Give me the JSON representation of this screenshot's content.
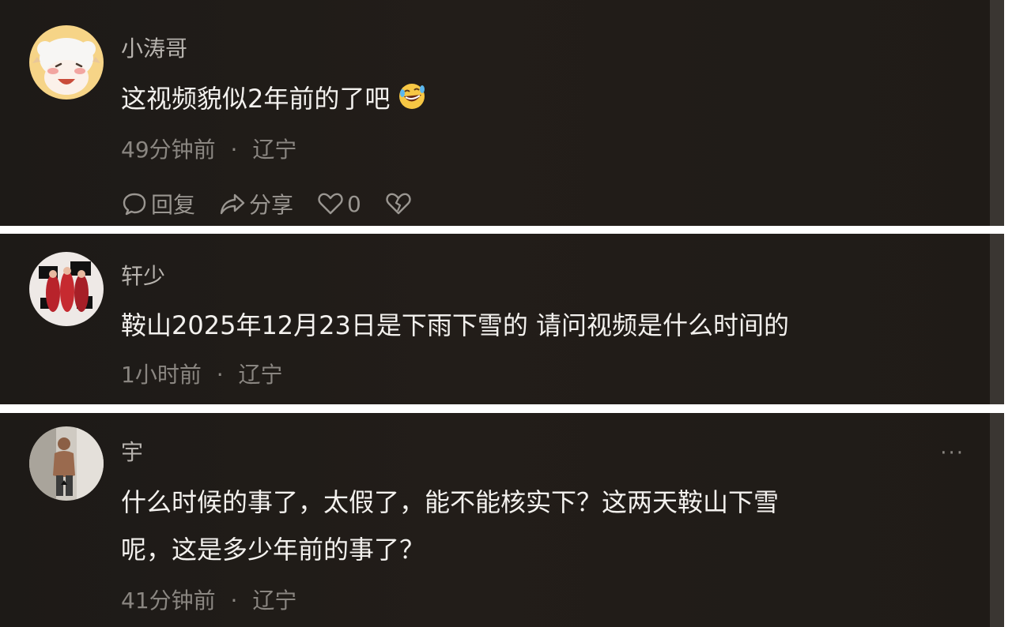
{
  "comments": [
    {
      "username": "小涛哥",
      "text": "这视频貌似2年前的了吧",
      "emoji": "rolling-on-floor-laughing-emoji",
      "time": "49分钟前",
      "location": "辽宁",
      "actions": {
        "reply": "回复",
        "share": "分享",
        "likes": "0"
      }
    },
    {
      "username": "轩少",
      "text": "鞍山2025年12月23日是下雨下雪的  请问视频是什么时间的",
      "time": "1小时前",
      "location": "辽宁"
    },
    {
      "username": "宇",
      "text_line1": "什么时候的事了，太假了，能不能核实下？这两天鞍山下雪",
      "text_line2": "呢，这是多少年前的事了？",
      "time": "41分钟前",
      "location": "辽宁",
      "more": "···"
    }
  ],
  "separator": "·"
}
